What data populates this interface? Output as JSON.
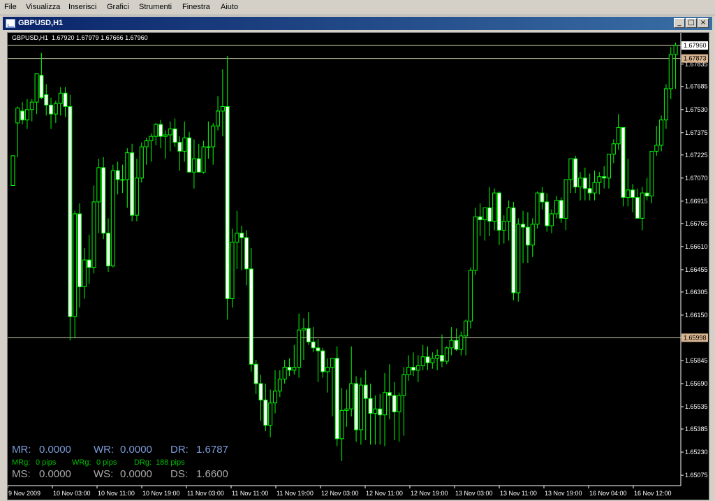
{
  "menu": [
    "File",
    "Visualizza",
    "Inserisci",
    "Grafici",
    "Strumenti",
    "Finestra",
    "Aiuto"
  ],
  "window": {
    "title": "GBPUSD,H1",
    "minimize_glyph": "_",
    "maximize_glyph": "□",
    "close_glyph": "×"
  },
  "chart_info": "GBPUSD,H1  1.67920 1.67979 1.67666 1.67960",
  "colors": {
    "background": "#000000",
    "candle_border": "#00ff00",
    "bull_fill": "#000000",
    "bear_fill": "#ffffff",
    "hline": "#cfcfa8",
    "price_tag_current": "#ffffff",
    "price_tag_level": "#d8b490",
    "stat_blue": "#7d9cd8",
    "stat_green": "#00c000",
    "stat_gray": "#aaaaaa"
  },
  "chart_data": {
    "type": "candlestick",
    "symbol": "GBPUSD",
    "timeframe": "H1",
    "ylim": [
      1.65005,
      1.68045
    ],
    "y_ticks": [
      "1.67960",
      "1.67835",
      "1.67685",
      "1.67530",
      "1.67375",
      "1.67225",
      "1.67070",
      "1.66915",
      "1.66765",
      "1.66610",
      "1.66455",
      "1.66305",
      "1.66150",
      "1.65998",
      "1.65845",
      "1.65690",
      "1.65535",
      "1.65385",
      "1.65230",
      "1.65075"
    ],
    "x_ticks": [
      "9 Nov 2009",
      "10 Nov 03:00",
      "10 Nov 11:00",
      "10 Nov 19:00",
      "11 Nov 03:00",
      "11 Nov 11:00",
      "11 Nov 19:00",
      "12 Nov 03:00",
      "12 Nov 11:00",
      "12 Nov 19:00",
      "13 Nov 03:00",
      "13 Nov 11:00",
      "13 Nov 19:00",
      "16 Nov 04:00",
      "16 Nov 12:00"
    ],
    "horizontal_lines": [
      {
        "price": 1.6796,
        "label": "1.67960",
        "style": "current"
      },
      {
        "price": 1.67873,
        "label": "1.67873",
        "style": "level"
      },
      {
        "price": 1.65998,
        "label": "1.65998",
        "style": "level"
      }
    ],
    "candles": [
      [
        1.6702,
        1.6721,
        1.6705,
        1.6722
      ],
      [
        1.6744,
        1.6755,
        1.6721,
        1.6754
      ],
      [
        1.6752,
        1.6758,
        1.6743,
        1.6746
      ],
      [
        1.6746,
        1.676,
        1.674,
        1.6753
      ],
      [
        1.6753,
        1.676,
        1.6745,
        1.6758
      ],
      [
        1.6758,
        1.6777,
        1.675,
        1.6777
      ],
      [
        1.6776,
        1.6791,
        1.676,
        1.6761
      ],
      [
        1.6763,
        1.677,
        1.6749,
        1.6756
      ],
      [
        1.6756,
        1.6761,
        1.674,
        1.675
      ],
      [
        1.675,
        1.6759,
        1.6744,
        1.6757
      ],
      [
        1.6757,
        1.6768,
        1.6749,
        1.6764
      ],
      [
        1.6764,
        1.6768,
        1.6748,
        1.6755
      ],
      [
        1.6755,
        1.6763,
        1.6598,
        1.6614
      ],
      [
        1.6614,
        1.6685,
        1.66,
        1.6683
      ],
      [
        1.6683,
        1.669,
        1.662,
        1.6634
      ],
      [
        1.6634,
        1.666,
        1.6626,
        1.6652
      ],
      [
        1.6652,
        1.6669,
        1.6636,
        1.6647
      ],
      [
        1.6647,
        1.6702,
        1.6643,
        1.6691
      ],
      [
        1.6691,
        1.672,
        1.667,
        1.6714
      ],
      [
        1.6714,
        1.6721,
        1.6666,
        1.667
      ],
      [
        1.667,
        1.668,
        1.6644,
        1.6648
      ],
      [
        1.6648,
        1.6716,
        1.6647,
        1.6712
      ],
      [
        1.6712,
        1.6718,
        1.6696,
        1.6706
      ],
      [
        1.6706,
        1.6716,
        1.6697,
        1.6706
      ],
      [
        1.6706,
        1.6727,
        1.6687,
        1.6724
      ],
      [
        1.6724,
        1.673,
        1.6678,
        1.6682
      ],
      [
        1.6682,
        1.672,
        1.6678,
        1.6707
      ],
      [
        1.6707,
        1.6731,
        1.6704,
        1.6728
      ],
      [
        1.6728,
        1.6734,
        1.6716,
        1.6732
      ],
      [
        1.6732,
        1.6737,
        1.6718,
        1.6735
      ],
      [
        1.6735,
        1.6744,
        1.6729,
        1.6743
      ],
      [
        1.6743,
        1.6746,
        1.6727,
        1.6735
      ],
      [
        1.6735,
        1.6739,
        1.672,
        1.6736
      ],
      [
        1.6736,
        1.6745,
        1.6725,
        1.674
      ],
      [
        1.674,
        1.6747,
        1.6728,
        1.6731
      ],
      [
        1.6731,
        1.6735,
        1.6712,
        1.6725
      ],
      [
        1.6725,
        1.6745,
        1.6718,
        1.6734
      ],
      [
        1.6734,
        1.6738,
        1.6711,
        1.6711
      ],
      [
        1.6711,
        1.6733,
        1.67,
        1.672
      ],
      [
        1.672,
        1.673,
        1.6712,
        1.6711
      ],
      [
        1.6711,
        1.6732,
        1.671,
        1.6728
      ],
      [
        1.6728,
        1.6745,
        1.672,
        1.6728
      ],
      [
        1.6728,
        1.6744,
        1.6716,
        1.6742
      ],
      [
        1.6742,
        1.6762,
        1.6739,
        1.6752
      ],
      [
        1.6752,
        1.678,
        1.6735,
        1.6755
      ],
      [
        1.6755,
        1.6789,
        1.6612,
        1.6626
      ],
      [
        1.6626,
        1.6673,
        1.662,
        1.6664
      ],
      [
        1.6664,
        1.6685,
        1.6646,
        1.667
      ],
      [
        1.667,
        1.6675,
        1.6645,
        1.6667
      ],
      [
        1.6667,
        1.6672,
        1.6635,
        1.6646
      ],
      [
        1.6646,
        1.666,
        1.6577,
        1.6582
      ],
      [
        1.6582,
        1.6585,
        1.6562,
        1.6569
      ],
      [
        1.6569,
        1.6575,
        1.6544,
        1.6558
      ],
      [
        1.6558,
        1.6569,
        1.6537,
        1.6541
      ],
      [
        1.6541,
        1.6565,
        1.6533,
        1.6556
      ],
      [
        1.6556,
        1.6578,
        1.6549,
        1.6564
      ],
      [
        1.6564,
        1.6578,
        1.656,
        1.6572
      ],
      [
        1.6572,
        1.6585,
        1.6569,
        1.658
      ],
      [
        1.658,
        1.6586,
        1.6574,
        1.6578
      ],
      [
        1.6578,
        1.6595,
        1.6575,
        1.658
      ],
      [
        1.658,
        1.6616,
        1.6573,
        1.6605
      ],
      [
        1.6605,
        1.6613,
        1.6585,
        1.6606
      ],
      [
        1.6606,
        1.6617,
        1.6595,
        1.6597
      ],
      [
        1.6597,
        1.6607,
        1.659,
        1.6593
      ],
      [
        1.6593,
        1.6599,
        1.657,
        1.6591
      ],
      [
        1.6591,
        1.6593,
        1.6573,
        1.6577
      ],
      [
        1.6577,
        1.6586,
        1.6563,
        1.658
      ],
      [
        1.658,
        1.658,
        1.6547,
        1.6586
      ],
      [
        1.6586,
        1.6594,
        1.6527,
        1.6532
      ],
      [
        1.6532,
        1.6566,
        1.6517,
        1.6551
      ],
      [
        1.6551,
        1.6565,
        1.654,
        1.6552
      ],
      [
        1.6552,
        1.6594,
        1.6547,
        1.6569
      ],
      [
        1.6569,
        1.6574,
        1.653,
        1.6538
      ],
      [
        1.6538,
        1.6573,
        1.6528,
        1.6568
      ],
      [
        1.6568,
        1.6578,
        1.6531,
        1.6559
      ],
      [
        1.6559,
        1.6569,
        1.6528,
        1.6549
      ],
      [
        1.6549,
        1.6561,
        1.6528,
        1.6552
      ],
      [
        1.6552,
        1.6562,
        1.6528,
        1.6548
      ],
      [
        1.6548,
        1.6576,
        1.6527,
        1.6563
      ],
      [
        1.6563,
        1.6582,
        1.6545,
        1.6561
      ],
      [
        1.6561,
        1.657,
        1.6531,
        1.655
      ],
      [
        1.655,
        1.6563,
        1.653,
        1.6561
      ],
      [
        1.6561,
        1.658,
        1.6534,
        1.6575
      ],
      [
        1.6575,
        1.6588,
        1.6571,
        1.658
      ],
      [
        1.658,
        1.659,
        1.6574,
        1.6578
      ],
      [
        1.6578,
        1.6588,
        1.657,
        1.6581
      ],
      [
        1.6581,
        1.6595,
        1.6578,
        1.6587
      ],
      [
        1.6587,
        1.6594,
        1.6578,
        1.6583
      ],
      [
        1.6583,
        1.659,
        1.6579,
        1.6586
      ],
      [
        1.6586,
        1.6592,
        1.6578,
        1.6588
      ],
      [
        1.6588,
        1.6602,
        1.658,
        1.6584
      ],
      [
        1.6584,
        1.6594,
        1.6582,
        1.6593
      ],
      [
        1.6593,
        1.6607,
        1.6588,
        1.6598
      ],
      [
        1.6598,
        1.6606,
        1.6591,
        1.6592
      ],
      [
        1.6592,
        1.6604,
        1.6588,
        1.6601
      ],
      [
        1.6601,
        1.6612,
        1.6588,
        1.6611
      ],
      [
        1.6611,
        1.6647,
        1.6606,
        1.6645
      ],
      [
        1.6645,
        1.6687,
        1.6642,
        1.6681
      ],
      [
        1.6681,
        1.669,
        1.6668,
        1.6679
      ],
      [
        1.6679,
        1.6687,
        1.6665,
        1.6687
      ],
      [
        1.6687,
        1.6701,
        1.6668,
        1.6678
      ],
      [
        1.6678,
        1.67,
        1.6672,
        1.6697
      ],
      [
        1.6697,
        1.6698,
        1.6662,
        1.6672
      ],
      [
        1.6672,
        1.6682,
        1.6663,
        1.6678
      ],
      [
        1.6678,
        1.6692,
        1.6665,
        1.6687
      ],
      [
        1.6687,
        1.6691,
        1.6625,
        1.663
      ],
      [
        1.663,
        1.668,
        1.6624,
        1.6676
      ],
      [
        1.6676,
        1.6685,
        1.665,
        1.6674
      ],
      [
        1.6674,
        1.6684,
        1.665,
        1.6662
      ],
      [
        1.6662,
        1.668,
        1.6654,
        1.6676
      ],
      [
        1.6676,
        1.6698,
        1.6673,
        1.6697
      ],
      [
        1.6697,
        1.6701,
        1.6686,
        1.6691
      ],
      [
        1.6691,
        1.6697,
        1.6671,
        1.6675
      ],
      [
        1.6675,
        1.6686,
        1.667,
        1.6683
      ],
      [
        1.6683,
        1.6695,
        1.668,
        1.6692
      ],
      [
        1.6692,
        1.6694,
        1.6677,
        1.668
      ],
      [
        1.668,
        1.6706,
        1.6672,
        1.6706
      ],
      [
        1.6706,
        1.6718,
        1.6697,
        1.672
      ],
      [
        1.672,
        1.6722,
        1.6697,
        1.6701
      ],
      [
        1.6701,
        1.6711,
        1.6692,
        1.6707
      ],
      [
        1.6707,
        1.6714,
        1.6692,
        1.67
      ],
      [
        1.67,
        1.671,
        1.6692,
        1.6697
      ],
      [
        1.6697,
        1.6712,
        1.6692,
        1.6704
      ],
      [
        1.6704,
        1.6711,
        1.6696,
        1.6708
      ],
      [
        1.6708,
        1.6715,
        1.67,
        1.6707
      ],
      [
        1.6707,
        1.6723,
        1.67,
        1.6723
      ],
      [
        1.6723,
        1.6733,
        1.6717,
        1.673
      ],
      [
        1.673,
        1.675,
        1.6726,
        1.6741
      ],
      [
        1.6741,
        1.6732,
        1.6688,
        1.6694
      ],
      [
        1.6694,
        1.672,
        1.6688,
        1.6699
      ],
      [
        1.6699,
        1.6703,
        1.6684,
        1.6694
      ],
      [
        1.6694,
        1.67,
        1.668,
        1.668
      ],
      [
        1.668,
        1.6701,
        1.6672,
        1.6697
      ],
      [
        1.6697,
        1.6707,
        1.6692,
        1.6695
      ],
      [
        1.6695,
        1.6725,
        1.669,
        1.6725
      ],
      [
        1.6725,
        1.6742,
        1.6722,
        1.6729
      ],
      [
        1.6729,
        1.6749,
        1.6725,
        1.6746
      ],
      [
        1.6746,
        1.677,
        1.674,
        1.6767
      ],
      [
        1.6767,
        1.6795,
        1.676,
        1.679
      ],
      [
        1.679,
        1.6798,
        1.6767,
        1.6796
      ]
    ]
  },
  "stats": {
    "row1": [
      {
        "key": "MR:",
        "val": "0.0000"
      },
      {
        "key": "WR:",
        "val": "0.0000"
      },
      {
        "key": "DR:",
        "val": "1.6787"
      }
    ],
    "row2": [
      {
        "key": "MRg:",
        "val": "0 pips"
      },
      {
        "key": "WRg:",
        "val": "0 pips"
      },
      {
        "key": "DRg:",
        "val": "188 pips"
      }
    ],
    "row3": [
      {
        "key": "MS:",
        "val": "0.0000"
      },
      {
        "key": "WS:",
        "val": "0.0000"
      },
      {
        "key": "DS:",
        "val": "1.6600"
      }
    ]
  }
}
